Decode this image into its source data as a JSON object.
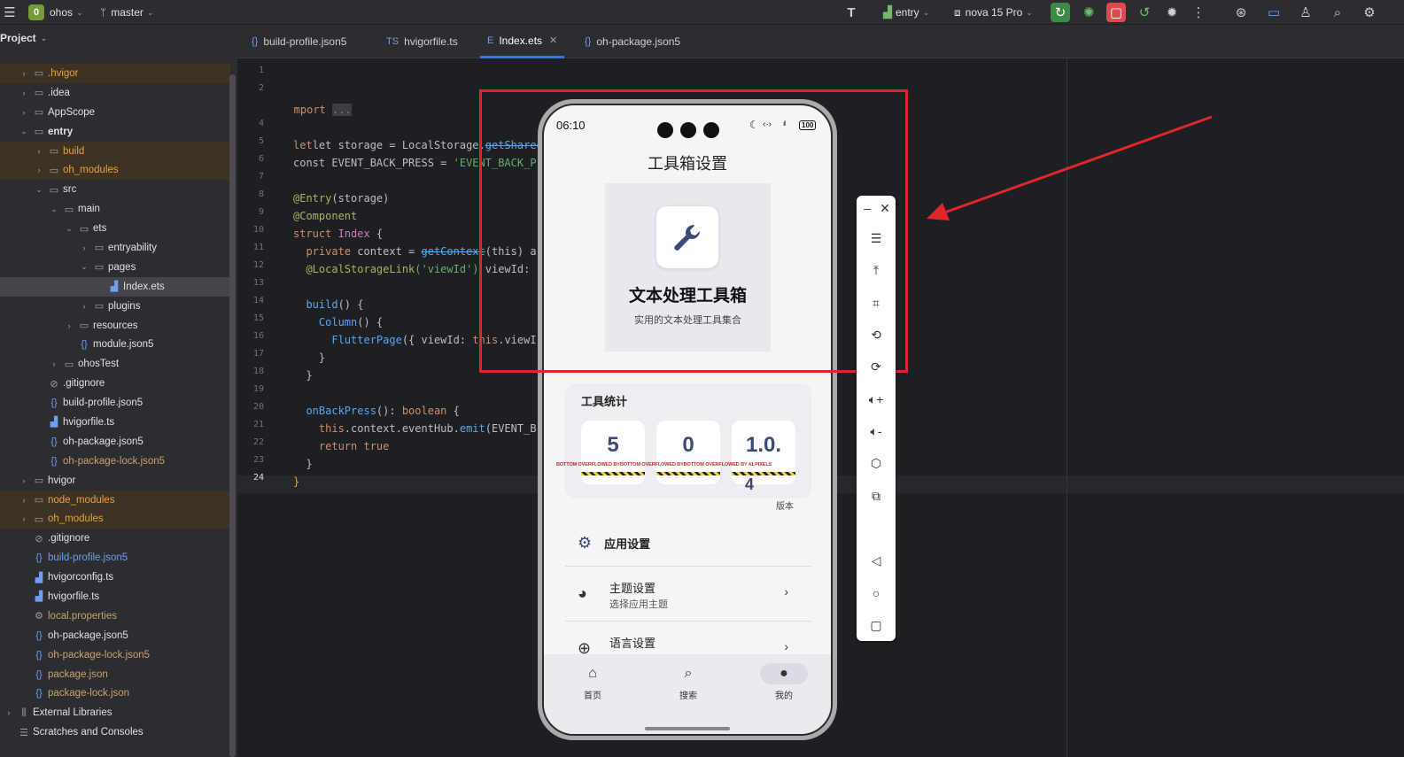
{
  "topbar": {
    "project_badge": "0",
    "project": "ohos",
    "branch": "master",
    "run_config": "entry",
    "device": "nova 15 Pro"
  },
  "sidebar": {
    "title": "Project",
    "items": [
      {
        "label": ".hvigor",
        "indent": 1,
        "type": "folder",
        "chev": "right",
        "style": "excl"
      },
      {
        "label": ".idea",
        "indent": 1,
        "type": "folder",
        "chev": "right",
        "style": ""
      },
      {
        "label": "AppScope",
        "indent": 1,
        "type": "folder",
        "chev": "right",
        "style": ""
      },
      {
        "label": "entry",
        "indent": 1,
        "type": "folder",
        "chev": "down",
        "style": "bold"
      },
      {
        "label": "build",
        "indent": 2,
        "type": "folder",
        "chev": "right",
        "style": "excl"
      },
      {
        "label": "oh_modules",
        "indent": 2,
        "type": "folder",
        "chev": "right",
        "style": "excl"
      },
      {
        "label": "src",
        "indent": 2,
        "type": "folder",
        "chev": "down",
        "style": ""
      },
      {
        "label": "main",
        "indent": 3,
        "type": "folder",
        "chev": "down",
        "style": ""
      },
      {
        "label": "ets",
        "indent": 4,
        "type": "folder",
        "chev": "down",
        "style": ""
      },
      {
        "label": "entryability",
        "indent": 5,
        "type": "folder",
        "chev": "right",
        "style": ""
      },
      {
        "label": "pages",
        "indent": 5,
        "type": "folder",
        "chev": "down",
        "style": ""
      },
      {
        "label": "Index.ets",
        "indent": 6,
        "type": "ets",
        "chev": "",
        "style": "sel"
      },
      {
        "label": "plugins",
        "indent": 5,
        "type": "folder",
        "chev": "right",
        "style": ""
      },
      {
        "label": "resources",
        "indent": 4,
        "type": "folder",
        "chev": "right",
        "style": ""
      },
      {
        "label": "module.json5",
        "indent": 4,
        "type": "json",
        "chev": "",
        "style": ""
      },
      {
        "label": "ohosTest",
        "indent": 3,
        "type": "folder",
        "chev": "right",
        "style": ""
      },
      {
        "label": ".gitignore",
        "indent": 2,
        "type": "ignore",
        "chev": "",
        "style": ""
      },
      {
        "label": "build-profile.json5",
        "indent": 2,
        "type": "json",
        "chev": "",
        "style": ""
      },
      {
        "label": "hvigorfile.ts",
        "indent": 2,
        "type": "ts",
        "chev": "",
        "style": ""
      },
      {
        "label": "oh-package.json5",
        "indent": 2,
        "type": "json",
        "chev": "",
        "style": ""
      },
      {
        "label": "oh-package-lock.json5",
        "indent": 2,
        "type": "json",
        "chev": "",
        "style": "excltext"
      },
      {
        "label": "hvigor",
        "indent": 1,
        "type": "folder",
        "chev": "right",
        "style": ""
      },
      {
        "label": "node_modules",
        "indent": 1,
        "type": "folder",
        "chev": "right",
        "style": "excl"
      },
      {
        "label": "oh_modules",
        "indent": 1,
        "type": "folder",
        "chev": "right",
        "style": "excl"
      },
      {
        "label": ".gitignore",
        "indent": 1,
        "type": "ignore",
        "chev": "",
        "style": ""
      },
      {
        "label": "build-profile.json5",
        "indent": 1,
        "type": "json",
        "chev": "",
        "style": "blue"
      },
      {
        "label": "hvigorconfig.ts",
        "indent": 1,
        "type": "ts",
        "chev": "",
        "style": ""
      },
      {
        "label": "hvigorfile.ts",
        "indent": 1,
        "type": "ts",
        "chev": "",
        "style": ""
      },
      {
        "label": "local.properties",
        "indent": 1,
        "type": "gear",
        "chev": "",
        "style": "excltext"
      },
      {
        "label": "oh-package.json5",
        "indent": 1,
        "type": "json",
        "chev": "",
        "style": ""
      },
      {
        "label": "oh-package-lock.json5",
        "indent": 1,
        "type": "json",
        "chev": "",
        "style": "excltext"
      },
      {
        "label": "package.json",
        "indent": 1,
        "type": "json",
        "chev": "",
        "style": "excltext"
      },
      {
        "label": "package-lock.json",
        "indent": 1,
        "type": "json",
        "chev": "",
        "style": "excltext"
      },
      {
        "label": "External Libraries",
        "indent": 0,
        "type": "lib",
        "chev": "right",
        "style": ""
      },
      {
        "label": "Scratches and Consoles",
        "indent": 0,
        "type": "scratch",
        "chev": "",
        "style": ""
      }
    ]
  },
  "tabs": [
    {
      "label": "build-profile.json5",
      "icon": "{}"
    },
    {
      "label": "hvigorfile.ts",
      "icon": "TS"
    },
    {
      "label": "Index.ets",
      "icon": "E",
      "active": true
    },
    {
      "label": "oh-package.json5",
      "icon": "{}"
    }
  ],
  "code_lines": {
    "l2": "import",
    "l2b": "...",
    "l5a": "let storage = LocalStorage.",
    "l5b": "getShared",
    "l5c": "()",
    "l6a": "const EVENT_BACK_PRESS = ",
    "l6b": "'EVENT_BACK_P",
    "l8a": "@Entry",
    "l8b": "(storage)",
    "l9": "@Component",
    "l10a": "struct ",
    "l10b": "Index",
    "l10c": " {",
    "l11a": "  private ",
    "l11b": "context = ",
    "l11c": "getContext",
    "l11d": "(this) a",
    "l12a": "  @LocalStorageLink",
    "l12b": "('viewId')",
    "l12c": " viewId:",
    "l14a": "  build",
    "l14b": "() {",
    "l15a": "    Column",
    "l15b": "() {",
    "l16a": "      FlutterPage",
    "l16b": "({ viewId: ",
    "l16c": "this",
    "l16d": ".viewI",
    "l17": "    }",
    "l18": "  }",
    "l20a": "  onBackPress",
    "l20b": "(): ",
    "l20c": "boolean",
    "l20d": " {",
    "l21a": "    this",
    "l21b": ".context.eventHub.",
    "l21c": "emit",
    "l21d": "(EVENT_B",
    "l22a": "    return ",
    "l22b": "true",
    "l23": "  }",
    "l24": "}"
  },
  "line_numbers": [
    "1",
    "2",
    "4",
    "5",
    "6",
    "7",
    "8",
    "9",
    "10",
    "11",
    "12",
    "13",
    "14",
    "15",
    "16",
    "17",
    "18",
    "19",
    "20",
    "21",
    "22",
    "23",
    "24"
  ],
  "phone": {
    "time": "06:10",
    "battery": "100",
    "page_title": "工具箱设置",
    "hero_title": "文本处理工具箱",
    "hero_subtitle": "实用的文本处理工具集合",
    "stats_title": "工具统计",
    "stats": [
      {
        "value": "5"
      },
      {
        "value": "0"
      },
      {
        "value": "1.0."
      }
    ],
    "stats_wrap_char": "4",
    "overflow_text": "BOTTOM OVERFLOWED BYBOTTOM OVERFLOWED BYBOTTOM OVERFLOWED BY 41 PIXELS",
    "version_label": "版本",
    "settings_header": "应用设置",
    "settings": [
      {
        "title": "主题设置",
        "subtitle": "选择应用主题"
      },
      {
        "title": "语言设置",
        "subtitle": ""
      }
    ],
    "nav": [
      {
        "label": "首页"
      },
      {
        "label": "搜索"
      },
      {
        "label": "我的",
        "active": true
      }
    ]
  },
  "colors": {
    "accent": "#3574f0",
    "annotation_red": "#e0252b",
    "stat_value": "#3d4a78"
  }
}
